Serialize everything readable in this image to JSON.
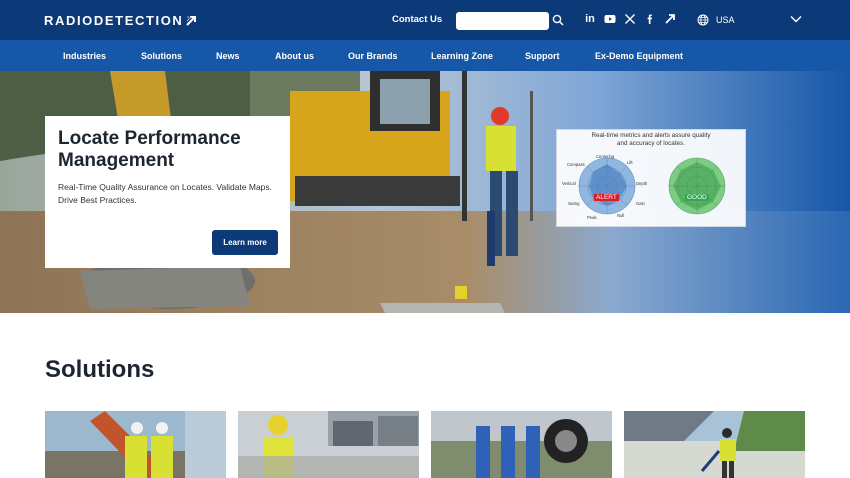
{
  "brand": {
    "name": "RADIODETECTION"
  },
  "header": {
    "contact_label": "Contact Us",
    "search_placeholder": "",
    "social_icons": [
      "linkedin-icon",
      "youtube-icon",
      "x-icon",
      "facebook-icon",
      "brand-arrow-icon"
    ],
    "region_label": "USA"
  },
  "nav": {
    "items": [
      "Industries",
      "Solutions",
      "News",
      "About us",
      "Our Brands",
      "Learning Zone",
      "Support",
      "Ex-Demo Equipment"
    ]
  },
  "hero": {
    "title": "Locate Performance Management",
    "subtitle": "Real-Time Quality Assurance on Locates. Validate Maps. Drive Best Practices.",
    "cta_label": "Learn more",
    "metrics_caption_line1": "Real-time metrics and alerts assure quality",
    "metrics_caption_line2": "and accuracy of locates.",
    "radar_labels": [
      "Centering",
      "Lift",
      "Depth",
      "Gain",
      "Null",
      "Peak",
      "Swing",
      "Vertical",
      "Compass"
    ],
    "alert_label": "ALERT",
    "good_label": "GOOD"
  },
  "solutions": {
    "title": "Solutions"
  },
  "colors": {
    "topbar": "#0c3a78",
    "nav": "#1657a8",
    "accent_button": "#0c3a78",
    "alert": "#d81c2a",
    "good": "#2fa84f"
  }
}
